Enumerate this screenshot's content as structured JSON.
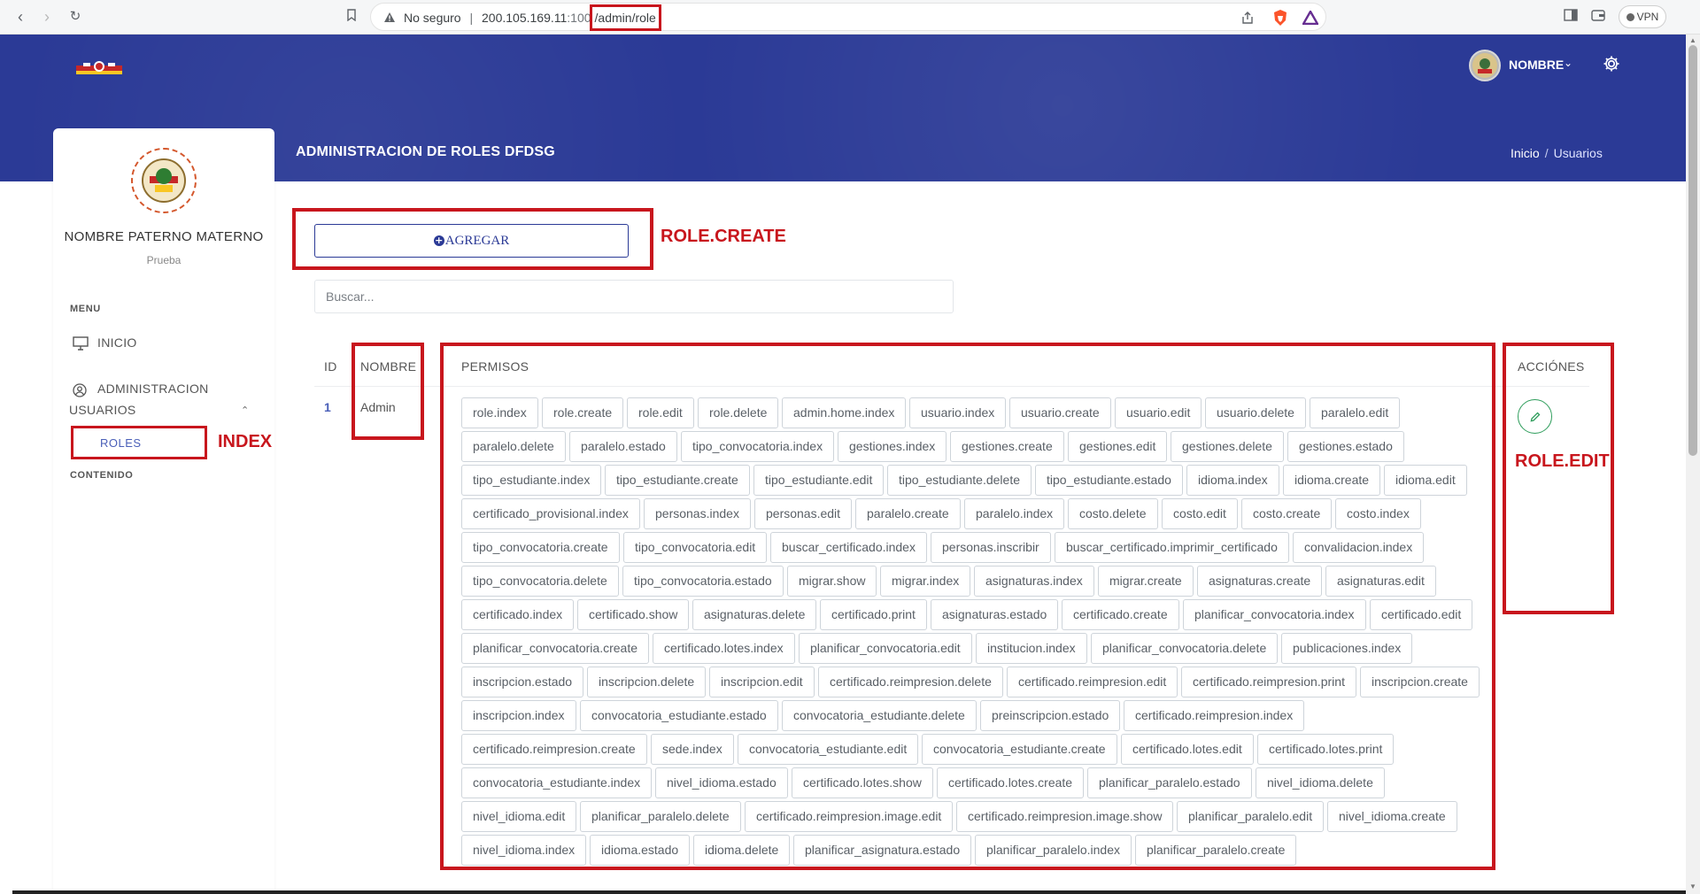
{
  "browser": {
    "security_label": "No seguro",
    "url_host": "200.105.169.11",
    "url_port": ":100",
    "url_path": "/admin/role",
    "vpn_label": "VPN"
  },
  "header": {
    "user_name": "NOMBRE",
    "page_title": "ADMINISTRACION DE ROLES DFDSG",
    "breadcrumb": [
      "Inicio",
      "Usuarios"
    ]
  },
  "sidebar": {
    "profile_name": "NOMBRE PATERNO MATERNO",
    "profile_role": "Prueba",
    "menu_heading": "MENU",
    "items": [
      {
        "label": "INICIO",
        "icon": "monitor-icon"
      },
      {
        "label": "ADMINISTRACION",
        "label2": "USUARIOS",
        "icon": "user-circle-icon"
      },
      {
        "label": "ROLES"
      }
    ],
    "content_heading": "CONTENIDO"
  },
  "annotations": {
    "create": "ROLE.CREATE",
    "index": "INDEX",
    "edit": "ROLE.EDIT"
  },
  "toolbar": {
    "add_label": "AGREGAR",
    "search_placeholder": "Buscar..."
  },
  "table": {
    "headers": {
      "id": "ID",
      "name": "NOMBRE",
      "permissions": "PERMISOS",
      "actions": "ACCIÓNES"
    },
    "rows": [
      {
        "id": "1",
        "name": "Admin",
        "permissions": [
          "role.index",
          "role.create",
          "role.edit",
          "role.delete",
          "admin.home.index",
          "usuario.index",
          "usuario.create",
          "usuario.edit",
          "usuario.delete",
          "paralelo.edit",
          "paralelo.delete",
          "paralelo.estado",
          "tipo_convocatoria.index",
          "gestiones.index",
          "gestiones.create",
          "gestiones.edit",
          "gestiones.delete",
          "gestiones.estado",
          "tipo_estudiante.index",
          "tipo_estudiante.create",
          "tipo_estudiante.edit",
          "tipo_estudiante.delete",
          "tipo_estudiante.estado",
          "idioma.index",
          "idioma.create",
          "idioma.edit",
          "certificado_provisional.index",
          "personas.index",
          "personas.edit",
          "paralelo.create",
          "paralelo.index",
          "costo.delete",
          "costo.edit",
          "costo.create",
          "costo.index",
          "tipo_convocatoria.create",
          "tipo_convocatoria.edit",
          "buscar_certificado.index",
          "personas.inscribir",
          "buscar_certificado.imprimir_certificado",
          "convalidacion.index",
          "tipo_convocatoria.delete",
          "tipo_convocatoria.estado",
          "migrar.show",
          "migrar.index",
          "asignaturas.index",
          "migrar.create",
          "asignaturas.create",
          "asignaturas.edit",
          "certificado.index",
          "certificado.show",
          "asignaturas.delete",
          "certificado.print",
          "asignaturas.estado",
          "certificado.create",
          "planificar_convocatoria.index",
          "certificado.edit",
          "planificar_convocatoria.create",
          "certificado.lotes.index",
          "planificar_convocatoria.edit",
          "institucion.index",
          "planificar_convocatoria.delete",
          "publicaciones.index",
          "inscripcion.estado",
          "inscripcion.delete",
          "inscripcion.edit",
          "certificado.reimpresion.delete",
          "certificado.reimpresion.edit",
          "certificado.reimpresion.print",
          "inscripcion.create",
          "inscripcion.index",
          "convocatoria_estudiante.estado",
          "convocatoria_estudiante.delete",
          "preinscripcion.estado",
          "certificado.reimpresion.index",
          "certificado.reimpresion.create",
          "sede.index",
          "convocatoria_estudiante.edit",
          "convocatoria_estudiante.create",
          "certificado.lotes.edit",
          "certificado.lotes.print",
          "convocatoria_estudiante.index",
          "nivel_idioma.estado",
          "certificado.lotes.show",
          "certificado.lotes.create",
          "planificar_paralelo.estado",
          "nivel_idioma.delete",
          "nivel_idioma.edit",
          "planificar_paralelo.delete",
          "certificado.reimpresion.image.edit",
          "certificado.reimpresion.image.show",
          "planificar_paralelo.edit",
          "nivel_idioma.create",
          "nivel_idioma.index",
          "idioma.estado",
          "idioma.delete",
          "planificar_asignatura.estado",
          "planificar_paralelo.index",
          "planificar_paralelo.create"
        ]
      }
    ]
  },
  "colors": {
    "brand": "#2b3a96",
    "annotation": "#c8161d",
    "edit_action": "#2e9d5b"
  }
}
